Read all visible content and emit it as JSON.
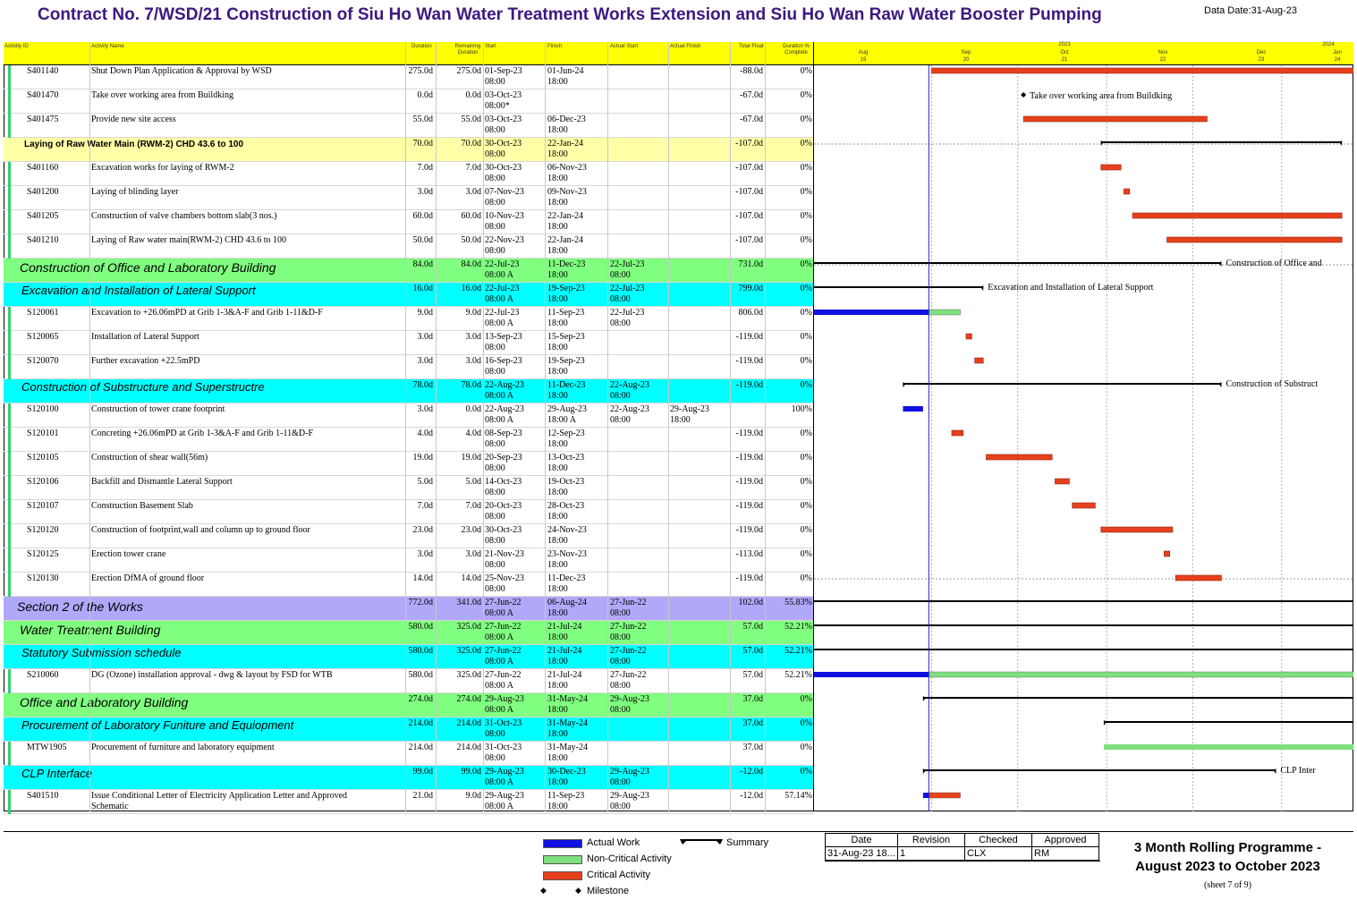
{
  "header": {
    "title": "Contract No. 7/WSD/21 Construction of Siu Ho Wan Water Treatment Works Extension and Siu Ho Wan Raw Water Booster Pumping",
    "data_date": "Data Date:31-Aug-23"
  },
  "columns": {
    "id": "Activity ID",
    "name": "Activity Name",
    "dur": "Duration",
    "rem": "Remaining Duration",
    "start": "Start",
    "finish": "Finish",
    "astart": "Actual Start",
    "afinish": "Actual Finish",
    "float": "Total Float",
    "pct": "Duration % Complete"
  },
  "timescale": {
    "years": [
      "2023",
      "2024"
    ],
    "months": [
      "Aug",
      "Sep",
      "Oct",
      "Nov",
      "Dec",
      "Jan"
    ],
    "weeks": [
      "19",
      "20",
      "21",
      "22",
      "23",
      "24"
    ]
  },
  "rows": [
    {
      "kind": "act",
      "id": "S401140",
      "name": "Shut Down Plan Application & Approval by WSD",
      "dur": "275.0d",
      "rem": "275.0d",
      "start": "01-Sep-23",
      "start2": "08:00",
      "finish": "01-Jun-24",
      "finish2": "18:00",
      "astart": "",
      "astart2": "",
      "afinish": "",
      "afinish2": "",
      "float": "-88.0d",
      "pct": "0%",
      "bar": {
        "type": "crit",
        "s": "2023-09-01",
        "e": "2024-06-01"
      }
    },
    {
      "kind": "act",
      "id": "S401470",
      "name": "Take over working area from Buildking",
      "dur": "0.0d",
      "rem": "0.0d",
      "start": "03-Oct-23",
      "start2": "08:00*",
      "finish": "",
      "finish2": "",
      "astart": "",
      "astart2": "",
      "afinish": "",
      "afinish2": "",
      "float": "-67.0d",
      "pct": "0%",
      "bar": {
        "type": "mile",
        "s": "2023-10-03",
        "label": "Take over working area from Buildking"
      }
    },
    {
      "kind": "act",
      "id": "S401475",
      "name": "Provide new site access",
      "dur": "55.0d",
      "rem": "55.0d",
      "start": "03-Oct-23",
      "start2": "08:00",
      "finish": "06-Dec-23",
      "finish2": "18:00",
      "astart": "",
      "astart2": "",
      "afinish": "",
      "afinish2": "",
      "float": "-67.0d",
      "pct": "0%",
      "bar": {
        "type": "crit",
        "s": "2023-10-03",
        "e": "2023-12-06"
      }
    },
    {
      "kind": "wbs",
      "level": "yellow",
      "name": "Laying of Raw Water Main (RWM-2) CHD 43.6 to 100",
      "dur": "70.0d",
      "rem": "70.0d",
      "start": "30-Oct-23",
      "start2": "08:00",
      "finish": "22-Jan-24",
      "finish2": "18:00",
      "astart": "",
      "astart2": "",
      "float": "-107.0d",
      "pct": "0%",
      "bar": {
        "type": "sum",
        "s": "2023-10-30",
        "e": "2024-01-22"
      }
    },
    {
      "kind": "act",
      "id": "S401160",
      "name": "Excavation works for laying of RWM-2",
      "dur": "7.0d",
      "rem": "7.0d",
      "start": "30-Oct-23",
      "start2": "08:00",
      "finish": "06-Nov-23",
      "finish2": "18:00",
      "astart": "",
      "astart2": "",
      "afinish": "",
      "afinish2": "",
      "float": "-107.0d",
      "pct": "0%",
      "bar": {
        "type": "crit",
        "s": "2023-10-30",
        "e": "2023-11-06"
      }
    },
    {
      "kind": "act",
      "id": "S401200",
      "name": "Laying of blinding layer",
      "dur": "3.0d",
      "rem": "3.0d",
      "start": "07-Nov-23",
      "start2": "08:00",
      "finish": "09-Nov-23",
      "finish2": "18:00",
      "astart": "",
      "astart2": "",
      "afinish": "",
      "afinish2": "",
      "float": "-107.0d",
      "pct": "0%",
      "bar": {
        "type": "crit",
        "s": "2023-11-07",
        "e": "2023-11-09"
      }
    },
    {
      "kind": "act",
      "id": "S401205",
      "name": "Construction of valve chambers bottom slab(3 nos.)",
      "dur": "60.0d",
      "rem": "60.0d",
      "start": "10-Nov-23",
      "start2": "08:00",
      "finish": "22-Jan-24",
      "finish2": "18:00",
      "astart": "",
      "astart2": "",
      "afinish": "",
      "afinish2": "",
      "float": "-107.0d",
      "pct": "0%",
      "bar": {
        "type": "crit",
        "s": "2023-11-10",
        "e": "2024-01-22"
      }
    },
    {
      "kind": "act",
      "id": "S401210",
      "name": "Laying of Raw water main(RWM-2) CHD 43.6 to 100",
      "dur": "50.0d",
      "rem": "50.0d",
      "start": "22-Nov-23",
      "start2": "08:00",
      "finish": "22-Jan-24",
      "finish2": "18:00",
      "astart": "",
      "astart2": "",
      "afinish": "",
      "afinish2": "",
      "float": "-107.0d",
      "pct": "0%",
      "bar": {
        "type": "crit",
        "s": "2023-11-22",
        "e": "2024-01-22"
      }
    },
    {
      "kind": "wbs",
      "level": "green",
      "name": "Construction of Office and Laboratory Building",
      "dur": "84.0d",
      "rem": "84.0d",
      "start": "22-Jul-23",
      "start2": "08:00 A",
      "finish": "11-Dec-23",
      "finish2": "18:00",
      "astart": "22-Jul-23",
      "astart2": "08:00",
      "float": "731.0d",
      "pct": "0%",
      "bar": {
        "type": "sum",
        "s": "2023-07-22",
        "e": "2023-12-11",
        "label": "Construction of Office and"
      }
    },
    {
      "kind": "wbs",
      "level": "cyan",
      "name": "Excavation and Installation of Lateral Support",
      "dur": "16.0d",
      "rem": "16.0d",
      "start": "22-Jul-23",
      "start2": "08:00 A",
      "finish": "19-Sep-23",
      "finish2": "18:00",
      "astart": "22-Jul-23",
      "astart2": "08:00",
      "float": "799.0d",
      "pct": "0%",
      "bar": {
        "type": "sum",
        "s": "2023-07-22",
        "e": "2023-09-19",
        "label": "Excavation and Installation of Lateral Support"
      }
    },
    {
      "kind": "act",
      "id": "S120061",
      "name": "Excavation to +26.06mPD at Grib 1-3&A-F and Grib 1-11&D-F",
      "dur": "9.0d",
      "rem": "9.0d",
      "start": "22-Jul-23",
      "start2": "08:00 A",
      "finish": "11-Sep-23",
      "finish2": "18:00",
      "astart": "22-Jul-23",
      "astart2": "08:00",
      "afinish": "",
      "afinish2": "",
      "float": "806.0d",
      "pct": "0%",
      "bar": {
        "type": "actnc",
        "s": "2023-07-22",
        "m": "2023-08-31",
        "e": "2023-09-11"
      }
    },
    {
      "kind": "act",
      "id": "S120065",
      "name": "Installation of Lateral Support",
      "dur": "3.0d",
      "rem": "3.0d",
      "start": "13-Sep-23",
      "start2": "08:00",
      "finish": "15-Sep-23",
      "finish2": "18:00",
      "astart": "",
      "astart2": "",
      "afinish": "",
      "afinish2": "",
      "float": "-119.0d",
      "pct": "0%",
      "bar": {
        "type": "crit",
        "s": "2023-09-13",
        "e": "2023-09-15"
      }
    },
    {
      "kind": "act",
      "id": "S120070",
      "name": "Further excavation +22.5mPD",
      "dur": "3.0d",
      "rem": "3.0d",
      "start": "16-Sep-23",
      "start2": "08:00",
      "finish": "19-Sep-23",
      "finish2": "18:00",
      "astart": "",
      "astart2": "",
      "afinish": "",
      "afinish2": "",
      "float": "-119.0d",
      "pct": "0%",
      "bar": {
        "type": "crit",
        "s": "2023-09-16",
        "e": "2023-09-19"
      }
    },
    {
      "kind": "wbs",
      "level": "cyan",
      "name": "Construction of Substructure and Superstructre",
      "dur": "78.0d",
      "rem": "78.0d",
      "start": "22-Aug-23",
      "start2": "08:00 A",
      "finish": "11-Dec-23",
      "finish2": "18:00",
      "astart": "22-Aug-23",
      "astart2": "08:00",
      "float": "-119.0d",
      "pct": "0%",
      "bar": {
        "type": "sum",
        "s": "2023-08-22",
        "e": "2023-12-11",
        "label": "Construction of Substruct"
      }
    },
    {
      "kind": "act",
      "id": "S120100",
      "name": "Construction of  tower crane footprint",
      "dur": "3.0d",
      "rem": "0.0d",
      "start": "22-Aug-23",
      "start2": "08:00 A",
      "finish": "29-Aug-23",
      "finish2": "18:00 A",
      "astart": "22-Aug-23",
      "astart2": "08:00",
      "afinish": "29-Aug-23",
      "afinish2": "18:00",
      "float": "",
      "pct": "100%",
      "bar": {
        "type": "actual",
        "s": "2023-08-22",
        "e": "2023-08-29"
      }
    },
    {
      "kind": "act",
      "id": "S120101",
      "name": "Concreting +26.06mPD at Grib 1-3&A-F and Grib 1-11&D-F",
      "dur": "4.0d",
      "rem": "4.0d",
      "start": "08-Sep-23",
      "start2": "08:00",
      "finish": "12-Sep-23",
      "finish2": "18:00",
      "astart": "",
      "astart2": "",
      "afinish": "",
      "afinish2": "",
      "float": "-119.0d",
      "pct": "0%",
      "bar": {
        "type": "crit",
        "s": "2023-09-08",
        "e": "2023-09-12"
      }
    },
    {
      "kind": "act",
      "id": "S120105",
      "name": "Construction of shear wall(56m)",
      "dur": "19.0d",
      "rem": "19.0d",
      "start": "20-Sep-23",
      "start2": "08:00",
      "finish": "13-Oct-23",
      "finish2": "18:00",
      "astart": "",
      "astart2": "",
      "afinish": "",
      "afinish2": "",
      "float": "-119.0d",
      "pct": "0%",
      "bar": {
        "type": "crit",
        "s": "2023-09-20",
        "e": "2023-10-13"
      }
    },
    {
      "kind": "act",
      "id": "S120106",
      "name": "Backfill and Dismantle Lateral Support",
      "dur": "5.0d",
      "rem": "5.0d",
      "start": "14-Oct-23",
      "start2": "08:00",
      "finish": "19-Oct-23",
      "finish2": "18:00",
      "astart": "",
      "astart2": "",
      "afinish": "",
      "afinish2": "",
      "float": "-119.0d",
      "pct": "0%",
      "bar": {
        "type": "crit",
        "s": "2023-10-14",
        "e": "2023-10-19"
      }
    },
    {
      "kind": "act",
      "id": "S120107",
      "name": "Construction Basement Slab",
      "dur": "7.0d",
      "rem": "7.0d",
      "start": "20-Oct-23",
      "start2": "08:00",
      "finish": "28-Oct-23",
      "finish2": "18:00",
      "astart": "",
      "astart2": "",
      "afinish": "",
      "afinish2": "",
      "float": "-119.0d",
      "pct": "0%",
      "bar": {
        "type": "crit",
        "s": "2023-10-20",
        "e": "2023-10-28"
      }
    },
    {
      "kind": "act",
      "id": "S120120",
      "name": "Construction of footprint,wall and column up to ground floor",
      "dur": "23.0d",
      "rem": "23.0d",
      "start": "30-Oct-23",
      "start2": "08:00",
      "finish": "24-Nov-23",
      "finish2": "18:00",
      "astart": "",
      "astart2": "",
      "afinish": "",
      "afinish2": "",
      "float": "-119.0d",
      "pct": "0%",
      "bar": {
        "type": "crit",
        "s": "2023-10-30",
        "e": "2023-11-24"
      }
    },
    {
      "kind": "act",
      "id": "S120125",
      "name": "Erection tower crane",
      "dur": "3.0d",
      "rem": "3.0d",
      "start": "21-Nov-23",
      "start2": "08:00",
      "finish": "23-Nov-23",
      "finish2": "18:00",
      "astart": "",
      "astart2": "",
      "afinish": "",
      "afinish2": "",
      "float": "-113.0d",
      "pct": "0%",
      "bar": {
        "type": "crit",
        "s": "2023-11-21",
        "e": "2023-11-23"
      }
    },
    {
      "kind": "act",
      "id": "S120130",
      "name": "Erection DfMA of ground floor",
      "dur": "14.0d",
      "rem": "14.0d",
      "start": "25-Nov-23",
      "start2": "08:00",
      "finish": "11-Dec-23",
      "finish2": "18:00",
      "astart": "",
      "astart2": "",
      "afinish": "",
      "afinish2": "",
      "float": "-119.0d",
      "pct": "0%",
      "bar": {
        "type": "crit",
        "s": "2023-11-25",
        "e": "2023-12-11"
      }
    },
    {
      "kind": "wbs",
      "level": "purple",
      "name": "Section 2 of the Works",
      "dur": "772.0d",
      "rem": "341.0d",
      "start": "27-Jun-22",
      "start2": "08:00 A",
      "finish": "06-Aug-24",
      "finish2": "18:00",
      "astart": "27-Jun-22",
      "astart2": "08:00",
      "float": "102.0d",
      "pct": "55.83%",
      "bar": {
        "type": "sum",
        "s": "2022-06-27",
        "e": "2024-08-06"
      }
    },
    {
      "kind": "wbs",
      "level": "green",
      "name": "Water Treatment Building",
      "dur": "580.0d",
      "rem": "325.0d",
      "start": "27-Jun-22",
      "start2": "08:00 A",
      "finish": "21-Jul-24",
      "finish2": "18:00",
      "astart": "27-Jun-22",
      "astart2": "08:00",
      "float": "57.0d",
      "pct": "52.21%",
      "bar": {
        "type": "sum",
        "s": "2022-06-27",
        "e": "2024-07-21"
      }
    },
    {
      "kind": "wbs",
      "level": "cyan",
      "name": "Statutory Submission schedule",
      "dur": "580.0d",
      "rem": "325.0d",
      "start": "27-Jun-22",
      "start2": "08:00 A",
      "finish": "21-Jul-24",
      "finish2": "18:00",
      "astart": "27-Jun-22",
      "astart2": "08:00",
      "float": "57.0d",
      "pct": "52.21%",
      "bar": {
        "type": "sum",
        "s": "2022-06-27",
        "e": "2024-07-21"
      }
    },
    {
      "kind": "act",
      "id": "S210060",
      "name": "DG (Ozone) installation approval - dwg & layout by FSD for WTB",
      "dur": "580.0d",
      "rem": "325.0d",
      "start": "27-Jun-22",
      "start2": "08:00 A",
      "finish": "21-Jul-24",
      "finish2": "18:00",
      "astart": "27-Jun-22",
      "astart2": "08:00",
      "afinish": "",
      "afinish2": "",
      "float": "57.0d",
      "pct": "52.21%",
      "bar": {
        "type": "actnc",
        "s": "2022-06-27",
        "m": "2023-08-31",
        "e": "2024-07-21"
      }
    },
    {
      "kind": "wbs",
      "level": "green",
      "name": "Office and Laboratory Building",
      "dur": "274.0d",
      "rem": "274.0d",
      "start": "29-Aug-23",
      "start2": "08:00 A",
      "finish": "31-May-24",
      "finish2": "18:00",
      "astart": "29-Aug-23",
      "astart2": "08:00",
      "float": "37.0d",
      "pct": "0%",
      "bar": {
        "type": "sum",
        "s": "2023-08-29",
        "e": "2024-05-31"
      }
    },
    {
      "kind": "wbs",
      "level": "cyan",
      "name": "Procurement of Laboratory Funiture and Equiopment",
      "dur": "214.0d",
      "rem": "214.0d",
      "start": "31-Oct-23",
      "start2": "08:00",
      "finish": "31-May-24",
      "finish2": "18:00",
      "astart": "",
      "astart2": "",
      "float": "37.0d",
      "pct": "0%",
      "bar": {
        "type": "sum",
        "s": "2023-10-31",
        "e": "2024-05-31"
      }
    },
    {
      "kind": "act",
      "id": "MTW1905",
      "name": "Procurement of furniture and laboratory equipment",
      "dur": "214.0d",
      "rem": "214.0d",
      "start": "31-Oct-23",
      "start2": "08:00",
      "finish": "31-May-24",
      "finish2": "18:00",
      "astart": "",
      "astart2": "",
      "afinish": "",
      "afinish2": "",
      "float": "37.0d",
      "pct": "0%",
      "bar": {
        "type": "nc",
        "s": "2023-10-31",
        "e": "2024-05-31"
      }
    },
    {
      "kind": "wbs",
      "level": "cyan",
      "name": "CLP Interface",
      "dur": "99.0d",
      "rem": "99.0d",
      "start": "29-Aug-23",
      "start2": "08:00 A",
      "finish": "30-Dec-23",
      "finish2": "18:00",
      "astart": "29-Aug-23",
      "astart2": "08:00",
      "float": "-12.0d",
      "pct": "0%",
      "bar": {
        "type": "sum",
        "s": "2023-08-29",
        "e": "2023-12-30",
        "label": "CLP Inter"
      }
    },
    {
      "kind": "act",
      "id": "S401510",
      "name": "Issue Conditional Letter of Electricity Application Letter and Approved",
      "name2": "Schematic",
      "dur": "21.0d",
      "rem": "9.0d",
      "start": "29-Aug-23",
      "start2": "08:00 A",
      "finish": "11-Sep-23",
      "finish2": "18:00",
      "astart": "29-Aug-23",
      "astart2": "08:00",
      "afinish": "",
      "afinish2": "",
      "float": "-12.0d",
      "pct": "57.14%",
      "bar": {
        "type": "actcrit",
        "s": "2023-08-29",
        "m": "2023-08-31",
        "e": "2023-09-11"
      }
    }
  ],
  "chart_data": {
    "type": "gantt",
    "data_date": "2023-08-31",
    "timeline_start": "2023-07-22",
    "timeline_end": "2024-01-26"
  },
  "legend": {
    "actual": "Actual Work",
    "noncritical": "Non-Critical Activity",
    "critical": "Critical Activity",
    "milestone": "Milestone",
    "summary": "Summary"
  },
  "colors": {
    "critical": "#e8401c",
    "noncritical": "#7fe07f",
    "actual": "#1010e0",
    "header": "#ffff00",
    "band_green": "#80ff80",
    "band_cyan": "#00ffff",
    "band_yellow": "#ffffa8",
    "band_purple": "#b0a8f8",
    "title": "#3d1880"
  },
  "footer": {
    "hdr_date": "Date",
    "hdr_revision": "Revision",
    "hdr_checked": "Checked",
    "hdr_approved": "Approved",
    "date": "31-Aug-23 18...",
    "revision": "1",
    "checked": "CLX",
    "approved": "RM",
    "title1": "3 Month Rolling Programme -",
    "title2": "August 2023 to October 2023",
    "sheet": "(sheet 7 of 9)"
  }
}
